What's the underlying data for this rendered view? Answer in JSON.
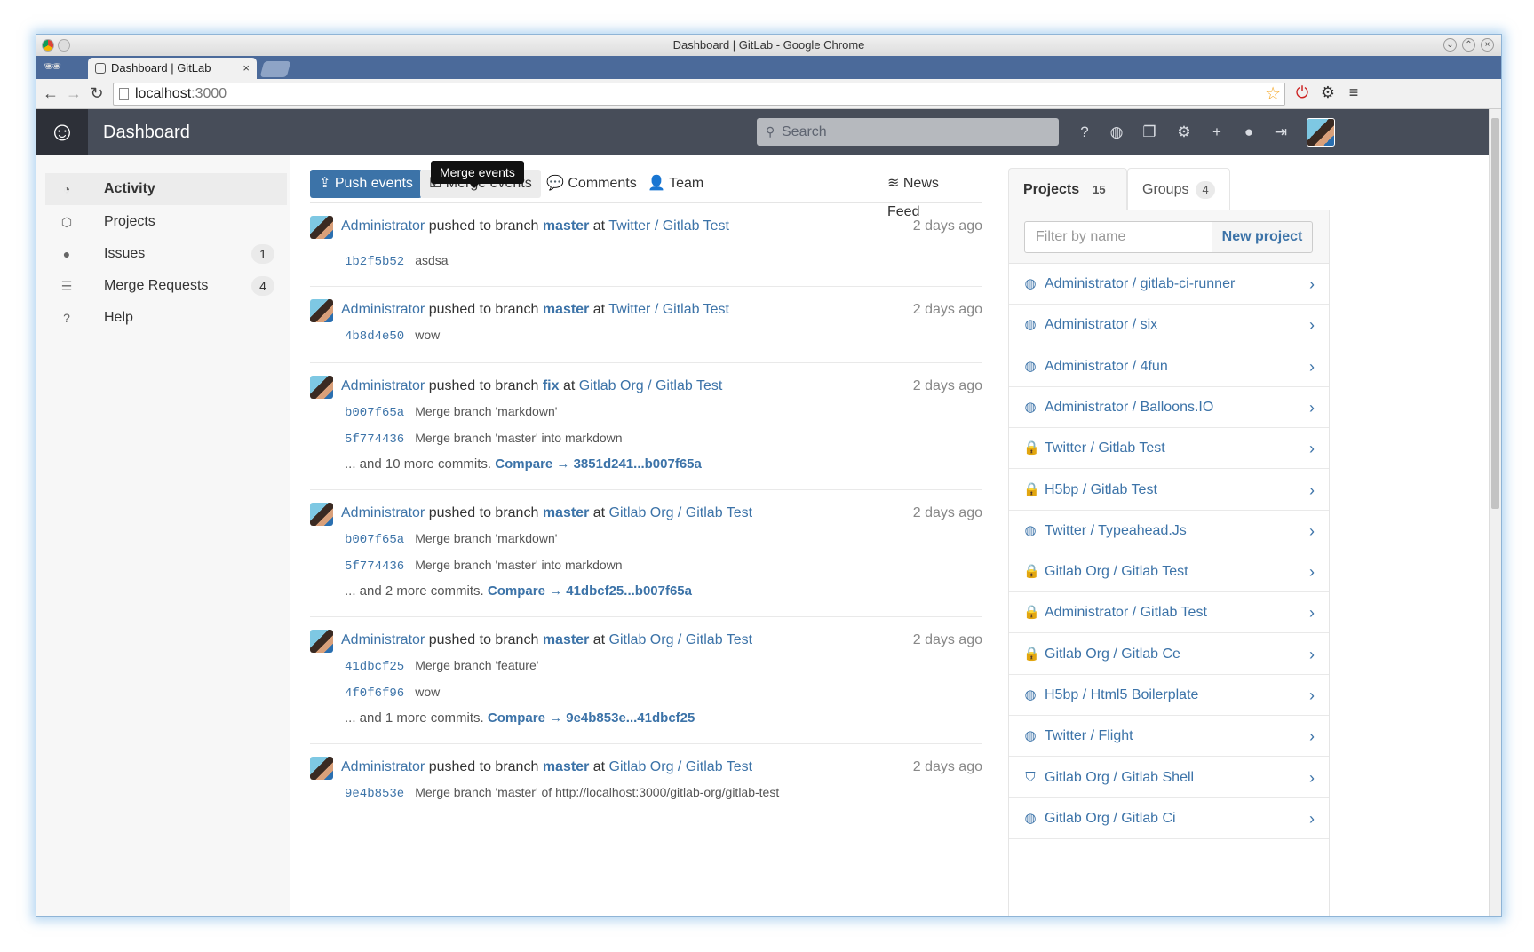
{
  "browser": {
    "window_title": "Dashboard | GitLab - Google Chrome",
    "tab_title": "Dashboard | GitLab",
    "tab_close": "×",
    "url_host": "localhost",
    "url_port": ":3000"
  },
  "header": {
    "title": "Dashboard",
    "search_placeholder": "Search"
  },
  "sidebar": {
    "items": [
      {
        "label": "Activity",
        "icon": "dashboard-icon",
        "badge": ""
      },
      {
        "label": "Projects",
        "icon": "cube-icon",
        "badge": ""
      },
      {
        "label": "Issues",
        "icon": "exclamation-circle-icon",
        "badge": "1"
      },
      {
        "label": "Merge Requests",
        "icon": "list-icon",
        "badge": "4"
      },
      {
        "label": "Help",
        "icon": "question-circle-icon",
        "badge": ""
      }
    ]
  },
  "filters": {
    "push": "Push events",
    "merge": "Merge events",
    "comments": "Comments",
    "team": "Team",
    "news_feed": "News Feed",
    "tooltip": "Merge events"
  },
  "events": [
    {
      "user": "Administrator",
      "action": "pushed to branch",
      "branch": "master",
      "at": "at",
      "project": "Twitter / Gitlab Test",
      "time": "2 days ago",
      "commits": [
        {
          "sha": "1b2f5b52",
          "msg": "asdsa"
        }
      ]
    },
    {
      "user": "Administrator",
      "action": "pushed to branch",
      "branch": "master",
      "at": "at",
      "project": "Twitter / Gitlab Test",
      "time": "2 days ago",
      "commits": [
        {
          "sha": "4b8d4e50",
          "msg": "wow"
        }
      ]
    },
    {
      "user": "Administrator",
      "action": "pushed to branch",
      "branch": "fix",
      "at": "at",
      "project": "Gitlab Org / Gitlab Test",
      "time": "2 days ago",
      "commits": [
        {
          "sha": "b007f65a",
          "msg": "Merge branch 'markdown'"
        },
        {
          "sha": "5f774436",
          "msg": "Merge branch 'master' into markdown"
        }
      ],
      "more": "... and 10 more commits.",
      "compare": "Compare → 3851d241...b007f65a"
    },
    {
      "user": "Administrator",
      "action": "pushed to branch",
      "branch": "master",
      "at": "at",
      "project": "Gitlab Org / Gitlab Test",
      "time": "2 days ago",
      "commits": [
        {
          "sha": "b007f65a",
          "msg": "Merge branch 'markdown'"
        },
        {
          "sha": "5f774436",
          "msg": "Merge branch 'master' into markdown"
        }
      ],
      "more": "... and 2 more commits.",
      "compare": "Compare → 41dbcf25...b007f65a"
    },
    {
      "user": "Administrator",
      "action": "pushed to branch",
      "branch": "master",
      "at": "at",
      "project": "Gitlab Org / Gitlab Test",
      "time": "2 days ago",
      "commits": [
        {
          "sha": "41dbcf25",
          "msg": "Merge branch 'feature'"
        },
        {
          "sha": "4f0f6f96",
          "msg": "wow"
        }
      ],
      "more": "... and 1 more commits.",
      "compare": "Compare → 9e4b853e...41dbcf25"
    },
    {
      "user": "Administrator",
      "action": "pushed to branch",
      "branch": "master",
      "at": "at",
      "project": "Gitlab Org / Gitlab Test",
      "time": "2 days ago",
      "commits": [
        {
          "sha": "9e4b853e",
          "msg": "Merge branch 'master' of http://localhost:3000/gitlab-org/gitlab-test"
        }
      ]
    }
  ],
  "panel": {
    "tab_projects": "Projects",
    "projects_count": "15",
    "tab_groups": "Groups",
    "groups_count": "4",
    "filter_placeholder": "Filter by name",
    "new_project": "New project",
    "projects": [
      {
        "name": "Administrator / gitlab-ci-runner",
        "visibility": "globe-icon"
      },
      {
        "name": "Administrator / six",
        "visibility": "globe-icon"
      },
      {
        "name": "Administrator / 4fun",
        "visibility": "globe-icon"
      },
      {
        "name": "Administrator / Balloons.IO",
        "visibility": "globe-icon"
      },
      {
        "name": "Twitter / Gitlab Test",
        "visibility": "lock-icon"
      },
      {
        "name": "H5bp / Gitlab Test",
        "visibility": "lock-icon"
      },
      {
        "name": "Twitter / Typeahead.Js",
        "visibility": "globe-icon"
      },
      {
        "name": "Gitlab Org / Gitlab Test",
        "visibility": "lock-icon"
      },
      {
        "name": "Administrator / Gitlab Test",
        "visibility": "lock-icon"
      },
      {
        "name": "Gitlab Org / Gitlab Ce",
        "visibility": "lock-icon"
      },
      {
        "name": "H5bp / Html5 Boilerplate",
        "visibility": "globe-icon"
      },
      {
        "name": "Twitter / Flight",
        "visibility": "globe-icon"
      },
      {
        "name": "Gitlab Org / Gitlab Shell",
        "visibility": "shield-icon"
      },
      {
        "name": "Gitlab Org / Gitlab Ci",
        "visibility": "globe-icon"
      }
    ]
  },
  "colors": {
    "header_bg": "#474d59",
    "link": "#3c73a8",
    "active_button": "#3c73a8"
  }
}
